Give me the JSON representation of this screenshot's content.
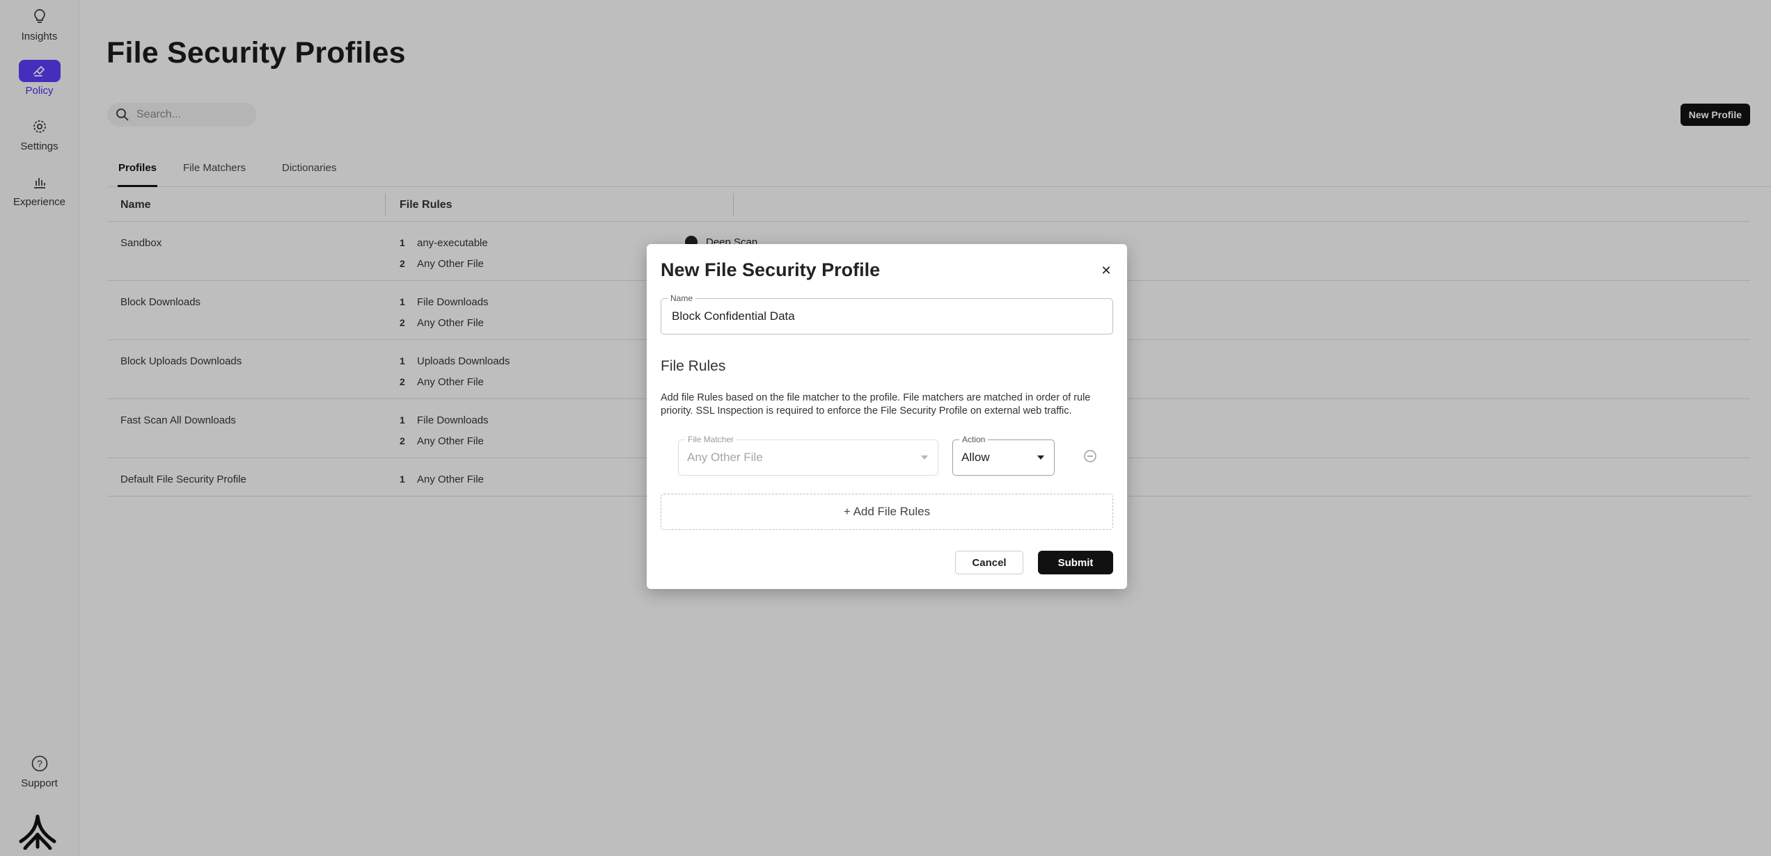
{
  "sidebar": {
    "items": [
      {
        "label": "Insights",
        "icon": "lightbulb-icon"
      },
      {
        "label": "Policy",
        "icon": "gavel-icon",
        "active": true
      },
      {
        "label": "Settings",
        "icon": "gear-icon"
      },
      {
        "label": "Experience",
        "icon": "bar-chart-icon"
      }
    ],
    "support": {
      "label": "Support",
      "icon": "question-circle-icon"
    }
  },
  "page": {
    "title": "File Security Profiles"
  },
  "search": {
    "placeholder": "Search..."
  },
  "toolbar": {
    "new_profile_label": "New Profile"
  },
  "tabs": [
    {
      "label": "Profiles",
      "active": true
    },
    {
      "label": "File Matchers"
    },
    {
      "label": "Dictionaries"
    }
  ],
  "table": {
    "columns": [
      "Name",
      "File Rules"
    ],
    "rows": [
      {
        "name": "Sandbox",
        "rules": [
          {
            "num": "1",
            "matcher": "any-executable"
          },
          {
            "num": "2",
            "matcher": "Any Other File"
          }
        ],
        "extra": "Deep Scan"
      },
      {
        "name": "Block Downloads",
        "rules": [
          {
            "num": "1",
            "matcher": "File Downloads"
          },
          {
            "num": "2",
            "matcher": "Any Other File"
          }
        ]
      },
      {
        "name": "Block Uploads Downloads",
        "rules": [
          {
            "num": "1",
            "matcher": "Uploads Downloads"
          },
          {
            "num": "2",
            "matcher": "Any Other File"
          }
        ]
      },
      {
        "name": "Fast Scan All Downloads",
        "rules": [
          {
            "num": "1",
            "matcher": "File Downloads"
          },
          {
            "num": "2",
            "matcher": "Any Other File"
          }
        ]
      },
      {
        "name": "Default File Security Profile",
        "rules": [
          {
            "num": "1",
            "matcher": "Any Other File"
          }
        ]
      }
    ]
  },
  "modal": {
    "title": "New File Security Profile",
    "close_icon": "close-icon",
    "name_field": {
      "label": "Name",
      "value": "Block Confidential Data"
    },
    "rules_section_title": "File Rules",
    "help_text": "Add file Rules based on the file matcher to the profile. File matchers are matched in order of rule priority. SSL Inspection is required to enforce the File Security Profile on external web traffic.",
    "rule": {
      "matcher_label": "File Matcher",
      "matcher_value": "Any Other File",
      "action_label": "Action",
      "action_value": "Allow"
    },
    "add_rules_label": "+ Add File Rules",
    "cancel_label": "Cancel",
    "submit_label": "Submit"
  },
  "colors": {
    "accent": "#5b3cf5",
    "primary_button": "#111111",
    "overlay": "rgba(0,0,0,0.23)"
  }
}
